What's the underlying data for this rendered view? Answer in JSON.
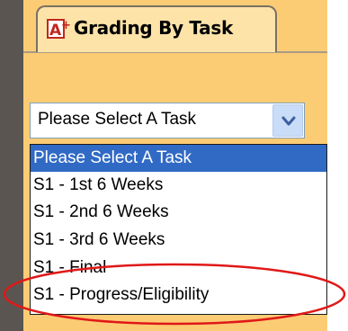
{
  "tab": {
    "icon": "grading-a-plus-icon",
    "title": "Grading By Task"
  },
  "task_select": {
    "selected_value": "Please Select A Task",
    "arrow_icon": "chevron-down-icon"
  },
  "task_options": [
    {
      "label": "Please Select A Task",
      "highlighted": true
    },
    {
      "label": "S1 - 1st 6 Weeks",
      "highlighted": false
    },
    {
      "label": "S1 - 2nd 6 Weeks",
      "highlighted": false
    },
    {
      "label": "S1 - 3rd 6 Weeks",
      "highlighted": false
    },
    {
      "label": "S1 - Final",
      "highlighted": false
    },
    {
      "label": "S1 - Progress/Eligibility",
      "highlighted": false
    }
  ],
  "annotation": {
    "shape": "ellipse",
    "color": "#e01818",
    "target_option": "S1 - Progress/Eligibility"
  },
  "colors": {
    "panel": "#fccc74",
    "tab": "#fde3a8",
    "frame": "#5b5552",
    "selection": "#316ac5"
  }
}
